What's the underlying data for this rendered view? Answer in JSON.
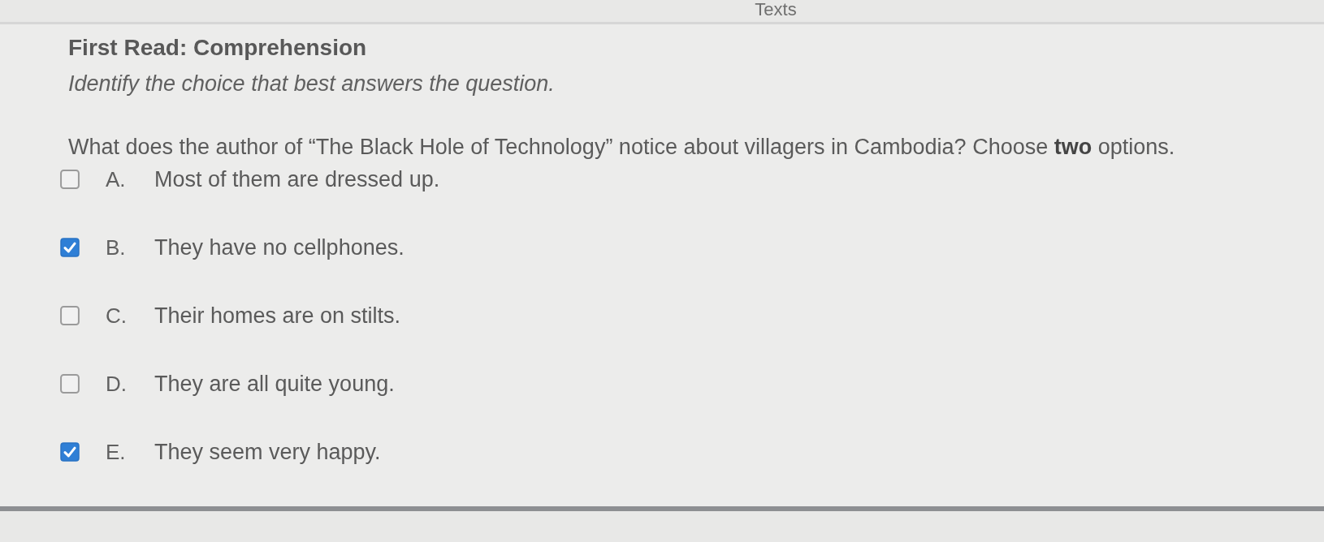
{
  "header": {
    "text": "Texts"
  },
  "title": "First Read: Comprehension",
  "instruction": "Identify the choice that best answers the question.",
  "question": "What does the author of “The Black Hole of Technology” notice about villagers in Cambodia? Choose **two** options.",
  "options": [
    {
      "letter": "A.",
      "text": "Most of them are dressed up.",
      "checked": false
    },
    {
      "letter": "B.",
      "text": "They have no cellphones.",
      "checked": true
    },
    {
      "letter": "C.",
      "text": "Their homes are on stilts.",
      "checked": false
    },
    {
      "letter": "D.",
      "text": "They are all quite young.",
      "checked": false
    },
    {
      "letter": "E.",
      "text": "They seem very happy.",
      "checked": true
    }
  ]
}
